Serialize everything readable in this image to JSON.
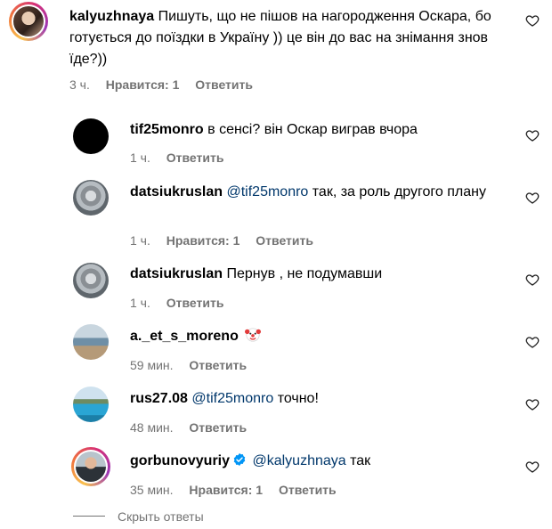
{
  "colors": {
    "meta": "#737373",
    "mention": "#00376b",
    "verified": "#0095f6"
  },
  "comments": [
    {
      "username": "kalyuzhnaya",
      "text": "Пишуть, що не пішов на нагородження Оскара, бо готується до поїздки в Україну )) це він до вас на знімання знов їде?))",
      "time": "3 ч.",
      "likes": "Нравится: 1",
      "reply": "Ответить",
      "avatar_icon": "profile-photo"
    },
    {
      "username": "tif25monro",
      "text": "в сенсі? він Оскар виграв вчора",
      "time": "1 ч.",
      "reply": "Ответить",
      "avatar_icon": "black-circle"
    },
    {
      "username": "datsiukruslan",
      "mention": "@tif25monro",
      "text": "так, за роль другого плану",
      "time": "1 ч.",
      "likes": "Нравится: 1",
      "reply": "Ответить",
      "avatar_icon": "statue-photo"
    },
    {
      "username": "datsiukruslan",
      "text": "Пернув , не подумавши",
      "time": "1 ч.",
      "reply": "Ответить",
      "avatar_icon": "statue-photo"
    },
    {
      "username": "a._et_s_moreno",
      "emoji_icon": "clown-face-emoji",
      "time": "59 мин.",
      "reply": "Ответить",
      "avatar_icon": "pier-photo"
    },
    {
      "username": "rus27.08",
      "mention": "@tif25monro",
      "text": "точно!",
      "time": "48 мин.",
      "reply": "Ответить",
      "avatar_icon": "pool-photo"
    },
    {
      "username": "gorbunovyuriy",
      "mention": "@kalyuzhnaya",
      "text": "так",
      "time": "35 мин.",
      "likes": "Нравится: 1",
      "reply": "Ответить",
      "avatar_icon": "man-photo",
      "verified": true
    }
  ],
  "hide_replies": "Скрыть ответы"
}
